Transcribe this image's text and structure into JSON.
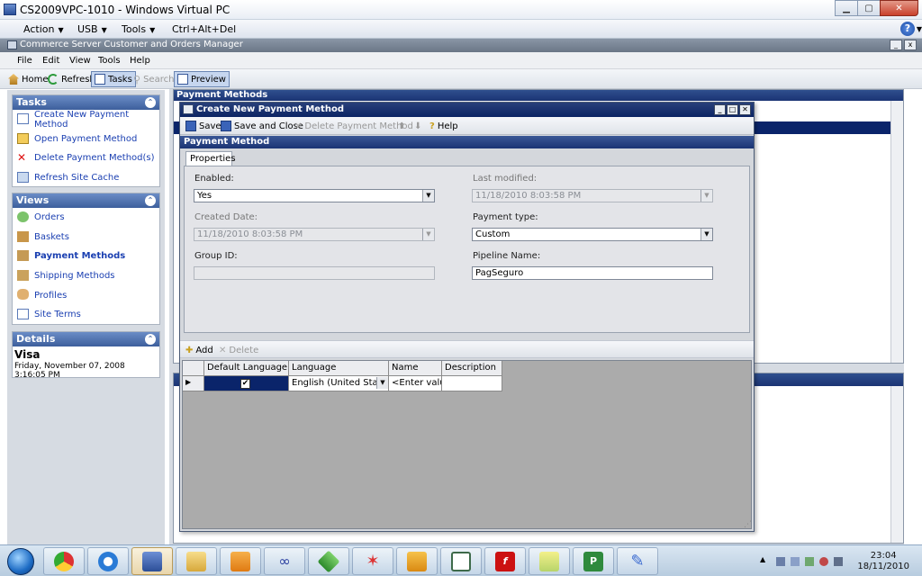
{
  "vpc": {
    "title": "CS2009VPC-1010 - Windows Virtual PC",
    "menu": [
      "Action",
      "USB",
      "Tools",
      "Ctrl+Alt+Del"
    ],
    "help_icon": "question-icon"
  },
  "app": {
    "title": "Commerce Server Customer and Orders Manager",
    "menu": [
      "File",
      "Edit",
      "View",
      "Tools",
      "Help"
    ],
    "toolbar": {
      "home": "Home",
      "refresh": "Refresh",
      "tasks": "Tasks",
      "search": "Search",
      "preview": "Preview"
    }
  },
  "tasks_panel": {
    "title": "Tasks",
    "items": [
      "Create New Payment Method",
      "Open Payment Method",
      "Delete Payment Method(s)",
      "Refresh Site Cache"
    ]
  },
  "views_panel": {
    "title": "Views",
    "items": [
      "Orders",
      "Baskets",
      "Payment Methods",
      "Shipping Methods",
      "Profiles",
      "Site Terms"
    ],
    "selected": "Payment Methods"
  },
  "details_panel": {
    "title": "Details",
    "name": "Visa",
    "date": "Friday, November 07, 2008 3:16:05 PM"
  },
  "main_list": {
    "title": "Payment Methods"
  },
  "dialog": {
    "title": "Create New Payment Method",
    "toolbar": {
      "save": "Save",
      "save_close": "Save and Close",
      "delete": "Delete Payment Method",
      "help": "Help"
    },
    "section": "Payment Method",
    "tab": "Properties",
    "fields": {
      "enabled_label": "Enabled:",
      "enabled_value": "Yes",
      "last_modified_label": "Last modified:",
      "last_modified_value": "11/18/2010   8:03:58 PM",
      "created_label": "Created Date:",
      "created_value": "11/18/2010   8:03:58 PM",
      "payment_type_label": "Payment type:",
      "payment_type_value": "Custom",
      "group_id_label": "Group ID:",
      "group_id_value": "",
      "pipeline_label": "Pipeline Name:",
      "pipeline_value": "PagSeguro"
    },
    "grid_toolbar": {
      "add": "Add",
      "delete": "Delete"
    },
    "grid": {
      "columns": [
        "Default Language",
        "Language",
        "Name",
        "Description"
      ],
      "row": {
        "language": "English (United States)",
        "name": "<Enter value>",
        "description": ""
      }
    }
  },
  "taskbar": {
    "time": "23:04",
    "date": "18/11/2010"
  }
}
